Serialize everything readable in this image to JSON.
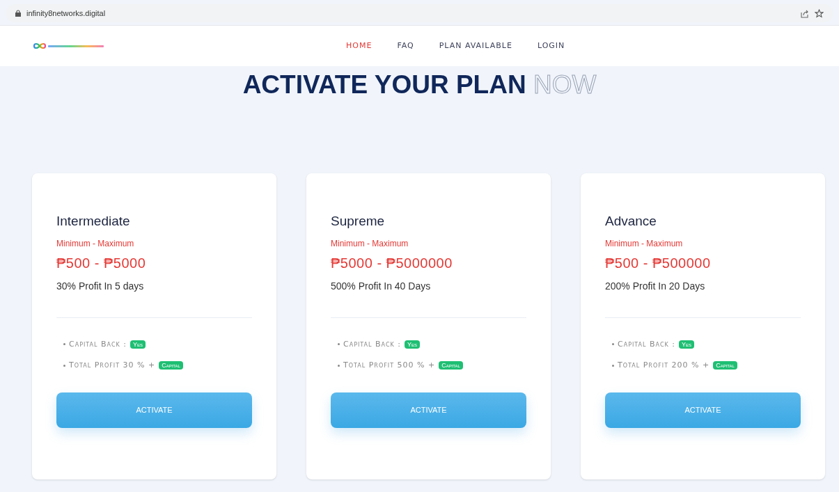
{
  "browser": {
    "url": "infinity8networks.digital"
  },
  "nav": [
    {
      "label": "HOME",
      "selected": true
    },
    {
      "label": "FAQ",
      "selected": false
    },
    {
      "label": "PLAN AVAILABLE",
      "selected": false
    },
    {
      "label": "LOGIN",
      "selected": false
    }
  ],
  "heading": {
    "main": "ACTIVATE YOUR PLAN",
    "outline": "NOW"
  },
  "plans": [
    {
      "name": "Intermediate",
      "range_label": "Minimum - Maximum",
      "range": "₱500 - ₱5000",
      "profit": "30% Profit In 5 days",
      "features": [
        {
          "text": "Capital Back :",
          "badge": "Yes"
        },
        {
          "text": "Total Profit 30 % +",
          "badge": "Capital"
        }
      ],
      "button": "ACTIVATE"
    },
    {
      "name": "Supreme",
      "range_label": "Minimum - Maximum",
      "range": "₱5000 - ₱5000000",
      "profit": "500% Profit In 40 Days",
      "features": [
        {
          "text": "Capital Back :",
          "badge": "Yes"
        },
        {
          "text": "Total Profit 500 % +",
          "badge": "Capital"
        }
      ],
      "button": "ACTIVATE"
    },
    {
      "name": "Advance",
      "range_label": "Minimum - Maximum",
      "range": "₱500 - ₱500000",
      "profit": "200% Profit In 20 Days",
      "features": [
        {
          "text": "Capital Back :",
          "badge": "Yes"
        },
        {
          "text": "Total Profit 200 % +",
          "badge": "Capital"
        }
      ],
      "button": "ACTIVATE"
    }
  ]
}
